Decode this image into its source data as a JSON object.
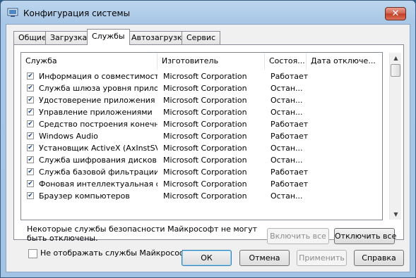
{
  "window": {
    "title": "Конфигурация системы",
    "close_glyph": "✕"
  },
  "tabs": [
    {
      "label": "Общие"
    },
    {
      "label": "Загрузка"
    },
    {
      "label": "Службы"
    },
    {
      "label": "Автозагрузка"
    },
    {
      "label": "Сервис"
    }
  ],
  "active_tab": "Службы",
  "columns": {
    "service": "Служба",
    "manufacturer": "Изготовитель",
    "status": "Состоя...",
    "disabled_date": "Дата отключе..."
  },
  "services": [
    {
      "checked": true,
      "name": "Информация о совместимости ...",
      "manufacturer": "Microsoft Corporation",
      "status": "Работает"
    },
    {
      "checked": true,
      "name": "Служба шлюза уровня прилож...",
      "manufacturer": "Microsoft Corporation",
      "status": "Остан..."
    },
    {
      "checked": true,
      "name": "Удостоверение приложения",
      "manufacturer": "Microsoft Corporation",
      "status": "Остан..."
    },
    {
      "checked": true,
      "name": "Управление приложениями",
      "manufacturer": "Microsoft Corporation",
      "status": "Остан..."
    },
    {
      "checked": true,
      "name": "Средство построения конечн...",
      "manufacturer": "Microsoft Corporation",
      "status": "Работает"
    },
    {
      "checked": true,
      "name": "Windows Audio",
      "manufacturer": "Microsoft Corporation",
      "status": "Работает"
    },
    {
      "checked": true,
      "name": "Установщик ActiveX (AxInstSV)",
      "manufacturer": "Microsoft Corporation",
      "status": "Остан..."
    },
    {
      "checked": true,
      "name": "Служба шифрования дисков Bi...",
      "manufacturer": "Microsoft Corporation",
      "status": "Остан..."
    },
    {
      "checked": true,
      "name": "Служба базовой фильтрации",
      "manufacturer": "Microsoft Corporation",
      "status": "Работает"
    },
    {
      "checked": true,
      "name": "Фоновая интеллектуальная с...",
      "manufacturer": "Microsoft Corporation",
      "status": "Работает"
    },
    {
      "checked": true,
      "name": "Браузер компьютеров",
      "manufacturer": "Microsoft Corporation",
      "status": "Остан..."
    }
  ],
  "check_glyph": "✔",
  "notice": "Некоторые службы безопасности Майкрософт не могут быть отключены.",
  "buttons": {
    "enable_all": "Включить все",
    "disable_all": "Отключить все",
    "ok": "ОК",
    "cancel": "Отмена",
    "apply": "Применить",
    "help": "Справка"
  },
  "hide_ms_label": "Не отображать службы Майкрософт",
  "hide_ms_checked": false,
  "scroll_up_glyph": "▲",
  "scroll_down_glyph": "▼"
}
